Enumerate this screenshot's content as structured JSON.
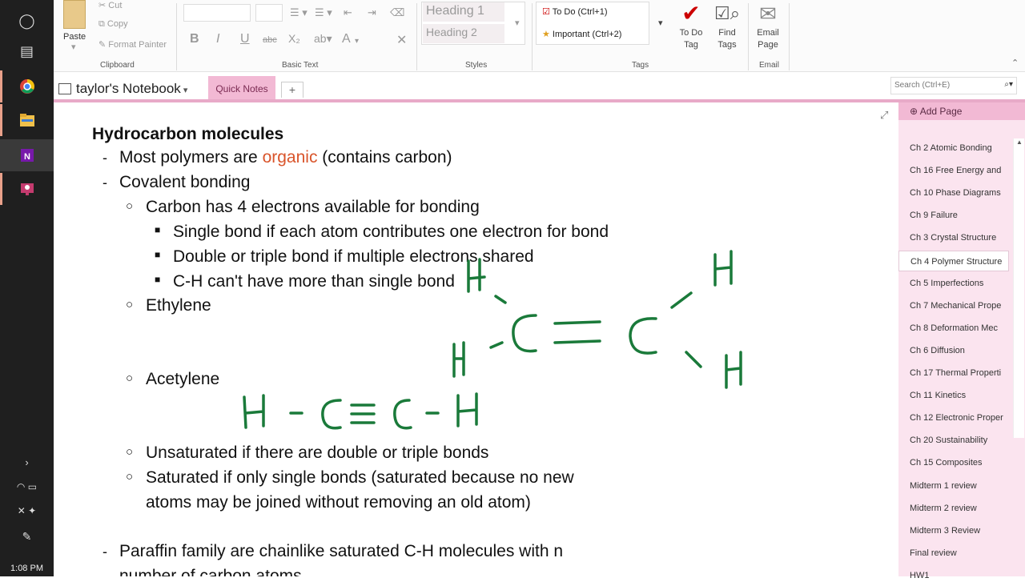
{
  "taskbar": {
    "icons": [
      "circle-icon",
      "task-view-icon",
      "chrome-icon",
      "file-explorer-icon",
      "onenote-icon",
      "teams-icon"
    ],
    "clock": "1:08 PM"
  },
  "ribbon": {
    "clipboard": {
      "paste": "Paste",
      "cut": "Cut",
      "copy": "Copy",
      "format_painter": "Format Painter",
      "group": "Clipboard"
    },
    "basic_text": {
      "group": "Basic Text",
      "buttons": [
        "B",
        "I",
        "U",
        "abc",
        "X₂",
        "A"
      ]
    },
    "styles": {
      "heading1": "Heading 1",
      "heading2": "Heading 2",
      "group": "Styles"
    },
    "tags": {
      "todo": "To Do (Ctrl+1)",
      "important": "Important (Ctrl+2)",
      "group": "Tags"
    },
    "todo_tag": "To Do Tag",
    "find_tags": "Find Tags",
    "email_page": "Email Page",
    "email_group": "Email"
  },
  "nav": {
    "notebook": "taylor's Notebook",
    "section_tab": "Quick Notes",
    "add_tab": "+",
    "search_placeholder": "Search (Ctrl+E)"
  },
  "note": {
    "title": "Hydrocarbon molecules",
    "lines": {
      "l1_pre": "Most polymers are ",
      "l1_hl": "organic",
      "l1_post": " (contains carbon)",
      "l2": "Covalent bonding",
      "l3": "Carbon has 4 electrons available for bonding",
      "l4": "Single bond if each atom contributes one electron for bond",
      "l5": "Double or triple bond if multiple electrons shared",
      "l6": "C-H can't have more than single bond",
      "l7": "Ethylene",
      "l8": "Acetylene",
      "l9": "Unsaturated if there are double or triple bonds",
      "l10": "Saturated if only single bonds (saturated because no new",
      "l11": "atoms may be joined without removing an old atom)",
      "l12": "Paraffin family are chainlike saturated C-H molecules with n",
      "l13": "number of carbon atoms"
    },
    "ink": {
      "acetylene": "H - C≡C - H",
      "ethylene_atoms": [
        "H",
        "H",
        "C",
        "C",
        "H",
        "H"
      ]
    }
  },
  "pages": {
    "add_page": "Add Page",
    "items": [
      "Ch 2 Atomic Bonding",
      "Ch 16 Free Energy and",
      "Ch 10 Phase Diagrams",
      "Ch 9 Failure",
      "Ch 3 Crystal Structure",
      "Ch 4 Polymer Structure",
      "Ch 5 Imperfections",
      "Ch 7 Mechanical Prope",
      "Ch 8 Deformation Mec",
      "Ch 6 Diffusion",
      "Ch 17 Thermal Properti",
      "Ch 11 Kinetics",
      "Ch 12 Electronic Proper",
      "Ch 20 Sustainability",
      "Ch 15 Composites",
      "Midterm 1 review",
      "Midterm 2 review",
      "Midterm 3 Review",
      "Final review",
      "HW1"
    ],
    "active_index": 5
  }
}
